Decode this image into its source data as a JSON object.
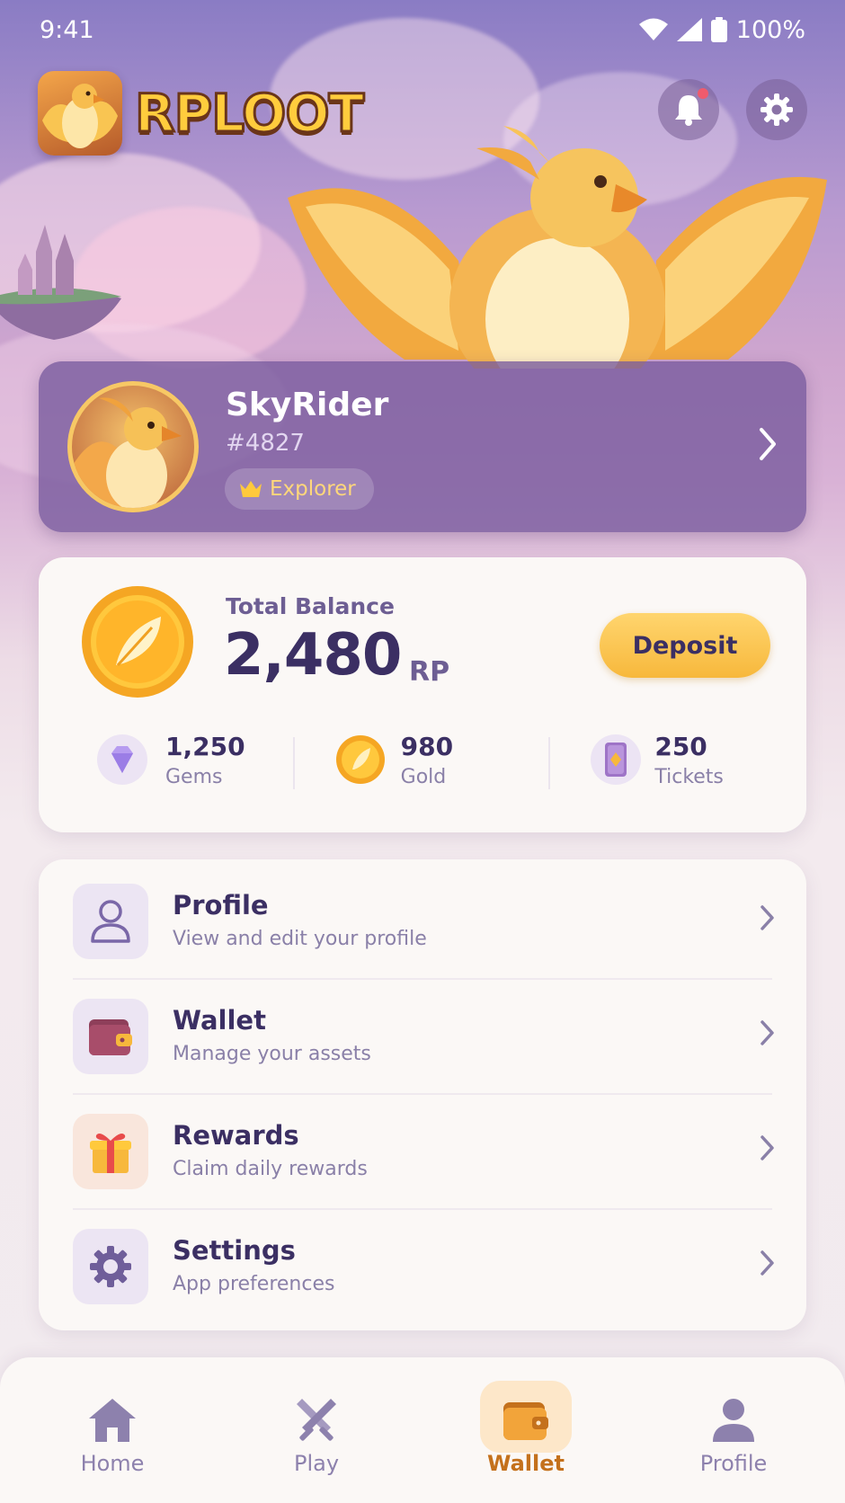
{
  "status_bar": {
    "time": "9:41",
    "battery": "100%"
  },
  "header": {
    "brand": "RPLOOT"
  },
  "profile": {
    "name": "SkyRider",
    "tag": "#4827",
    "badge": "Explorer"
  },
  "balance": {
    "label": "Total Balance",
    "value": "2,480",
    "unit": "RP",
    "deposit_label": "Deposit"
  },
  "assets": [
    {
      "value": "1,250",
      "label": "Gems"
    },
    {
      "value": "980",
      "label": "Gold"
    },
    {
      "value": "250",
      "label": "Tickets"
    }
  ],
  "menu": [
    {
      "title": "Profile",
      "subtitle": "View and edit your profile"
    },
    {
      "title": "Wallet",
      "subtitle": "Manage your assets"
    },
    {
      "title": "Rewards",
      "subtitle": "Claim daily rewards"
    },
    {
      "title": "Settings",
      "subtitle": "App preferences"
    }
  ],
  "nav": [
    {
      "label": "Home"
    },
    {
      "label": "Play"
    },
    {
      "label": "Wallet"
    },
    {
      "label": "Profile"
    }
  ],
  "colors": {
    "accent": "#F7B83C",
    "text": "#3B2F63",
    "active_nav": "#C4711C",
    "card": "#FBF8F6"
  }
}
